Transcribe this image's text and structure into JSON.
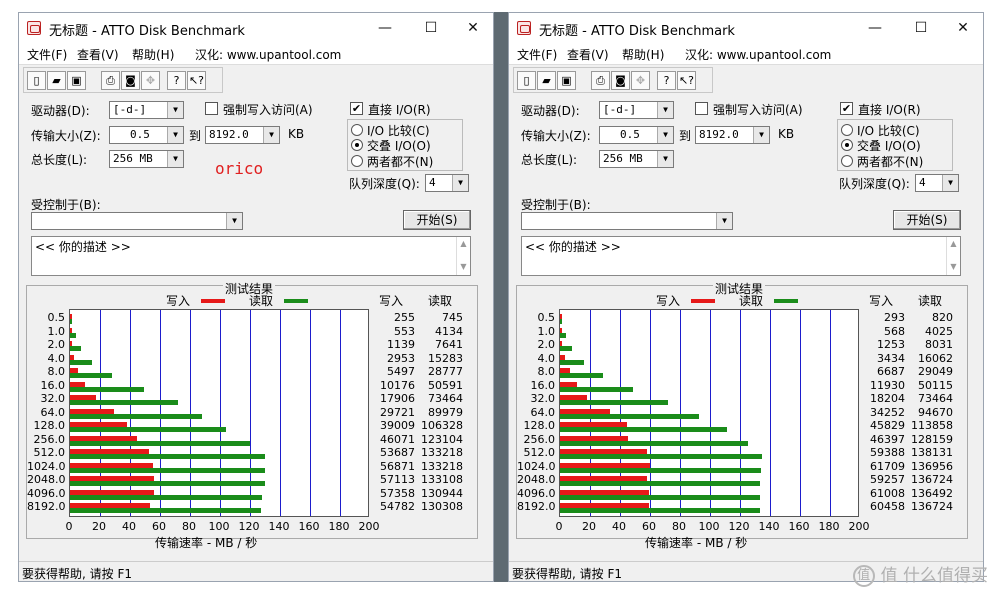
{
  "windows": [
    {
      "title": "无标题 - ATTO Disk Benchmark",
      "overlay_text": "orico",
      "menu": [
        "文件(F)",
        "查看(V)",
        "帮助(H)",
        "汉化: www.upantool.com"
      ],
      "drive_label": "驱动器(D):",
      "drive_value": "[-d-]",
      "force_write_label": "强制写入访问(A)",
      "direct_io_label": "直接 I/O(R)",
      "direct_io_mark": "✔",
      "transfer_label": "传输大小(Z):",
      "transfer_from": "0.5",
      "to_label": "到",
      "transfer_to": "8192.0",
      "kb_unit": "KB",
      "length_label": "总长度(L):",
      "length_value": "256 MB",
      "io_compare": "I/O 比较(C)",
      "overlap_io": "交叠 I/O(O)",
      "neither": "两者都不(N)",
      "queue_label": "队列深度(Q):",
      "queue_value": "4",
      "controlled_label": "受控制于(B):",
      "controlled_value": "",
      "start_label": "开始(S)",
      "desc_text": "<<  你的描述  >>",
      "results_title": "测试结果",
      "legend_write": "写入",
      "legend_read": "读取",
      "col_write": "写入",
      "col_read": "读取",
      "x_axis_label": "传输速率 - MB / 秒",
      "status": "要获得帮助, 请按 F1"
    },
    {
      "title": "无标题 - ATTO Disk Benchmark",
      "overlay_text": "",
      "menu": [
        "文件(F)",
        "查看(V)",
        "帮助(H)",
        "汉化: www.upantool.com"
      ],
      "drive_label": "驱动器(D):",
      "drive_value": "[-d-]",
      "force_write_label": "强制写入访问(A)",
      "direct_io_label": "直接 I/O(R)",
      "direct_io_mark": "✔",
      "transfer_label": "传输大小(Z):",
      "transfer_from": "0.5",
      "to_label": "到",
      "transfer_to": "8192.0",
      "kb_unit": "KB",
      "length_label": "总长度(L):",
      "length_value": "256 MB",
      "io_compare": "I/O 比较(C)",
      "overlap_io": "交叠 I/O(O)",
      "neither": "两者都不(N)",
      "queue_label": "队列深度(Q):",
      "queue_value": "4",
      "controlled_label": "受控制于(B):",
      "controlled_value": "",
      "start_label": "开始(S)",
      "desc_text": "<<  你的描述  >>",
      "results_title": "测试结果",
      "legend_write": "写入",
      "legend_read": "读取",
      "col_write": "写入",
      "col_read": "读取",
      "x_axis_label": "传输速率 - MB / 秒",
      "status": "要获得帮助, 请按 F1"
    }
  ],
  "watermark": "值 什么值得买",
  "colors": {
    "write": "#e61919",
    "read": "#1a8c1a",
    "grid": "#1d1dcc"
  },
  "chart_data": [
    {
      "type": "bar",
      "categories": [
        "0.5",
        "1.0",
        "2.0",
        "4.0",
        "8.0",
        "16.0",
        "32.0",
        "64.0",
        "128.0",
        "256.0",
        "512.0",
        "1024.0",
        "2048.0",
        "4096.0",
        "8192.0"
      ],
      "x_ticks": [
        "0",
        "20",
        "40",
        "60",
        "80",
        "100",
        "120",
        "140",
        "160",
        "180",
        "200"
      ],
      "xlim": [
        0,
        200
      ],
      "series": [
        {
          "name": "写入",
          "values": [
            255,
            553,
            1139,
            2953,
            5497,
            10176,
            17906,
            29721,
            39009,
            46071,
            53687,
            56871,
            57113,
            57358,
            54782
          ]
        },
        {
          "name": "读取",
          "values": [
            745,
            4134,
            7641,
            15283,
            28777,
            50591,
            73464,
            89979,
            106328,
            123104,
            133218,
            133218,
            133108,
            130944,
            130308
          ]
        }
      ]
    },
    {
      "type": "bar",
      "categories": [
        "0.5",
        "1.0",
        "2.0",
        "4.0",
        "8.0",
        "16.0",
        "32.0",
        "64.0",
        "128.0",
        "256.0",
        "512.0",
        "1024.0",
        "2048.0",
        "4096.0",
        "8192.0"
      ],
      "x_ticks": [
        "0",
        "20",
        "40",
        "60",
        "80",
        "100",
        "120",
        "140",
        "160",
        "180",
        "200"
      ],
      "xlim": [
        0,
        200
      ],
      "series": [
        {
          "name": "写入",
          "values": [
            293,
            568,
            1253,
            3434,
            6687,
            11930,
            18204,
            34252,
            45829,
            46397,
            59388,
            61709,
            59257,
            61008,
            60458
          ]
        },
        {
          "name": "读取",
          "values": [
            820,
            4025,
            8031,
            16062,
            29049,
            50115,
            73464,
            94670,
            113858,
            128159,
            138131,
            136956,
            136724,
            136492,
            136724
          ]
        }
      ]
    }
  ]
}
